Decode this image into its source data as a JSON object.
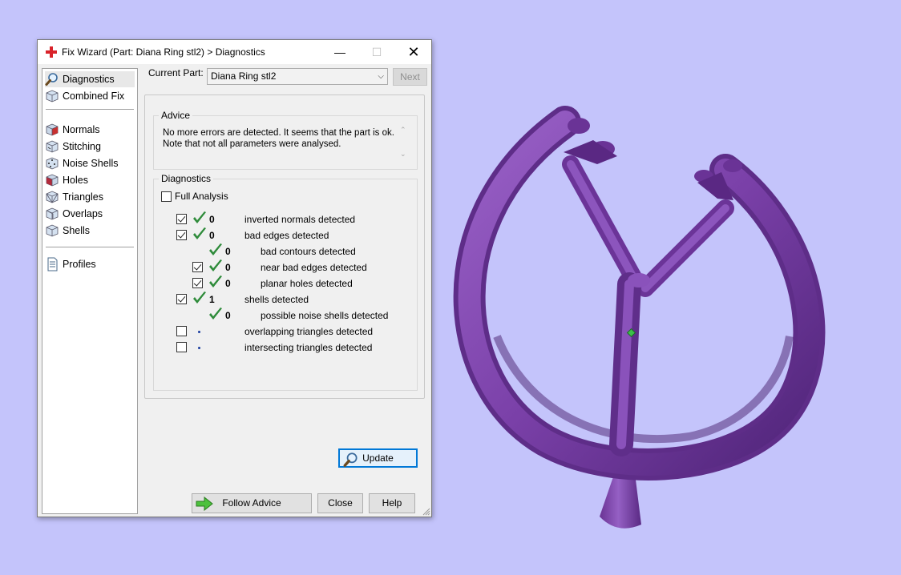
{
  "window": {
    "title": "Fix Wizard (Part: Diana Ring stl2) > Diagnostics",
    "minimize_glyph": "—",
    "maximize_glyph": "☐",
    "close_glyph": "✕"
  },
  "sidebar": {
    "items": [
      {
        "label": "Diagnostics",
        "icon": "magnifier-icon",
        "selected": true
      },
      {
        "label": "Combined Fix",
        "icon": "combined-fix-cube-icon"
      },
      {
        "label": "Normals",
        "icon": "normals-cube-icon"
      },
      {
        "label": "Stitching",
        "icon": "stitching-cube-icon"
      },
      {
        "label": "Noise Shells",
        "icon": "noise-shells-cube-icon"
      },
      {
        "label": "Holes",
        "icon": "holes-cube-icon"
      },
      {
        "label": "Triangles",
        "icon": "triangles-cube-icon"
      },
      {
        "label": "Overlaps",
        "icon": "overlaps-cube-icon"
      },
      {
        "label": "Shells",
        "icon": "shells-cube-icon"
      },
      {
        "label": "Profiles",
        "icon": "document-icon"
      }
    ]
  },
  "current_part": {
    "label": "Current Part:",
    "value": "Diana Ring stl2",
    "next_label": "Next"
  },
  "advice": {
    "title": "Advice",
    "text_line1": "No more errors are detected. It seems that the part is ok.",
    "text_line2": "Note that not all parameters were analysed."
  },
  "diagnostics": {
    "title": "Diagnostics",
    "full_analysis_label": "Full Analysis",
    "rows": [
      {
        "checked": true,
        "status": "ok",
        "count": "0",
        "label": "inverted normals detected"
      },
      {
        "checked": true,
        "status": "ok",
        "count": "0",
        "label": "bad edges detected"
      },
      {
        "checked": null,
        "status": "ok",
        "count": "0",
        "label": "bad contours detected"
      },
      {
        "checked": true,
        "status": "ok",
        "count": "0",
        "label": "near bad edges detected"
      },
      {
        "checked": true,
        "status": "ok",
        "count": "0",
        "label": "planar holes detected"
      },
      {
        "checked": true,
        "status": "ok",
        "count": "1",
        "label": "shells detected"
      },
      {
        "checked": null,
        "status": "ok",
        "count": "0",
        "label": "possible noise shells detected"
      },
      {
        "checked": false,
        "status": "pending",
        "count": "",
        "label": "overlapping triangles detected"
      },
      {
        "checked": false,
        "status": "pending",
        "count": "",
        "label": "intersecting triangles detected"
      }
    ],
    "update_label": "Update"
  },
  "footer": {
    "follow_advice_label": "Follow Advice",
    "close_label": "Close",
    "help_label": "Help"
  },
  "colors": {
    "background": "#c4c4fb",
    "model_purple": "#7b43a8",
    "tick_green": "#2e8b3a",
    "accent_blue": "#0078d7"
  }
}
